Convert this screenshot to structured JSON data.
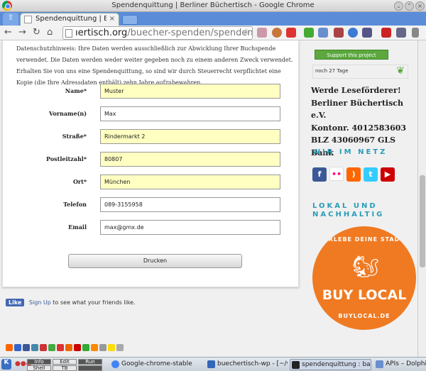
{
  "window": {
    "title": "Spendenquittung | Berliner Büchertisch - Google Chrome"
  },
  "tab": {
    "label": "Spendenquittung | Berlin",
    "close": "×"
  },
  "omnibox": {
    "url_host": "ıertisch.org",
    "url_path": "/buecher-spenden/spendenquittung/"
  },
  "privacy_text": "Datenschutzhinweis: Ihre Daten werden ausschließlich zur Abwicklung Ihrer Buchspende verwendet. Die Daten werden weder weiter gegeben noch zu einem anderen Zweck verwendet. Erhalten Sie von uns eine Spendenquittung, so sind wir durch Steuerrecht verpflichtet eine Kopie (die Ihre Adressdaten enthält) zehn Jahre aufzubewahren.",
  "form": {
    "fields": [
      {
        "label": "Name*",
        "value": "Muster",
        "required": true
      },
      {
        "label": "Vorname(n)",
        "value": "Max",
        "required": false
      },
      {
        "label": "Straße*",
        "value": "Rindermarkt 2",
        "required": true
      },
      {
        "label": "Postleitzahl*",
        "value": "80807",
        "required": true
      },
      {
        "label": "Ort*",
        "value": "München",
        "required": true
      },
      {
        "label": "Telefon",
        "value": "089-3155958",
        "required": false
      },
      {
        "label": "Email",
        "value": "max@gmx.de",
        "required": false
      }
    ],
    "submit_label": "Drucken"
  },
  "facebook": {
    "like_label": "Like",
    "signup_label": "Sign Up",
    "suffix": "to see what your friends like."
  },
  "sidebar": {
    "support_label": "Support this project",
    "days_left": "noch 27 Tage",
    "bank_lines": [
      "Werde Leseförderer!",
      "Berliner Büchertisch e.V.",
      "Kontonr. 4012583603",
      "BLZ 43060967 GLS Bank"
    ],
    "net_heading": "WIR IM NETZ",
    "local_heading_1": "LOKAL UND",
    "local_heading_2": "NACHHALTIG",
    "buylocal_top": "ERLEBE DEINE STADT",
    "buylocal_main": "BUY LOCAL",
    "buylocal_bottom": "BUYLOCAL.DE"
  },
  "taskbar": {
    "pager": [
      "Info",
      "Edit",
      "Run",
      "Shell",
      "TB",
      ""
    ],
    "tasks": [
      {
        "label": "Google-chrome-stable",
        "color": "#4285f4",
        "active": false
      },
      {
        "label": "buechertisch-wp - [~/work",
        "color": "#3367b8",
        "active": false
      },
      {
        "label": "spendenquittung : bash -",
        "color": "#222222",
        "active": true
      },
      {
        "label": "APIs – Dolphin",
        "color": "#6a8fd0",
        "active": false
      }
    ]
  }
}
